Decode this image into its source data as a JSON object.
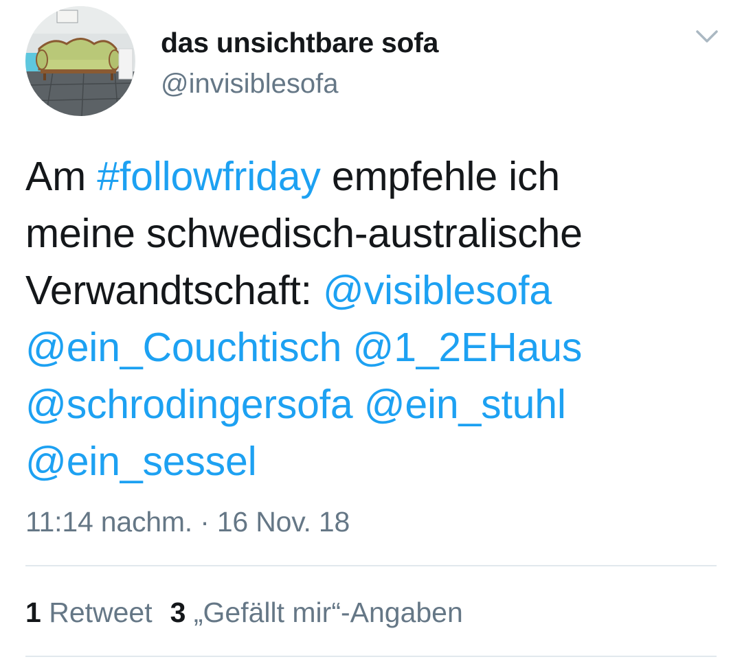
{
  "user": {
    "display_name": "das unsichtbare sofa",
    "handle": "@invisiblesofa",
    "avatar_description": "green-sofa-photo"
  },
  "menu": {
    "icon": "chevron-down-icon"
  },
  "tweet": {
    "lines": [
      [
        {
          "text": "Am ",
          "type": "text"
        },
        {
          "text": "#followfriday",
          "type": "hashtag"
        },
        {
          "text": " empfehle ich",
          "type": "text"
        }
      ],
      [
        {
          "text": "meine schwedisch-australische",
          "type": "text"
        }
      ],
      [
        {
          "text": "Verwandtschaft: ",
          "type": "text"
        },
        {
          "text": "@visiblesofa",
          "type": "mention"
        }
      ],
      [
        {
          "text": "@ein_Couchtisch",
          "type": "mention"
        },
        {
          "text": " ",
          "type": "text"
        },
        {
          "text": "@1_2EHaus",
          "type": "mention"
        }
      ],
      [
        {
          "text": "@schrodingersofa",
          "type": "mention"
        },
        {
          "text": " ",
          "type": "text"
        },
        {
          "text": "@ein_stuhl",
          "type": "mention"
        }
      ],
      [
        {
          "text": "@ein_sessel",
          "type": "mention"
        }
      ]
    ]
  },
  "timestamp": "11:14 nachm. · 16 Nov. 18",
  "stats": {
    "retweets_count": "1",
    "retweets_label": "Retweet",
    "likes_count": "3",
    "likes_label": "„Gefällt mir“-Angaben"
  },
  "colors": {
    "link": "#1da1f2",
    "text": "#14171a",
    "secondary": "#657786",
    "divider": "#e1e8ed"
  }
}
